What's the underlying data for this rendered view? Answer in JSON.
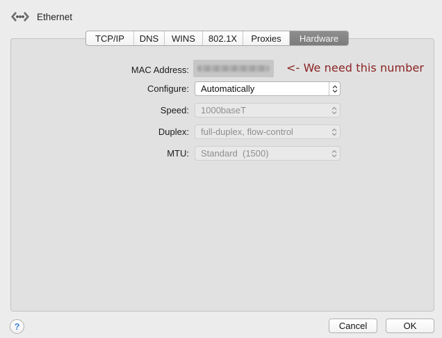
{
  "window": {
    "title": "Ethernet"
  },
  "tabs": [
    {
      "label": "TCP/IP"
    },
    {
      "label": "DNS"
    },
    {
      "label": "WINS"
    },
    {
      "label": "802.1X"
    },
    {
      "label": "Proxies"
    },
    {
      "label": "Hardware",
      "active": true
    }
  ],
  "form": {
    "mac_address": {
      "label": "MAC Address:"
    },
    "configure": {
      "label": "Configure:",
      "value": "Automatically"
    },
    "speed": {
      "label": "Speed:",
      "value": "1000baseT"
    },
    "duplex": {
      "label": "Duplex:",
      "value": "full-duplex, flow-control"
    },
    "mtu": {
      "label": "MTU:",
      "value": "Standard  (1500)"
    }
  },
  "annotation": {
    "text": "<- We need this number",
    "color": "#8b2323"
  },
  "footer": {
    "help_label": "?",
    "cancel_label": "Cancel",
    "ok_label": "OK"
  }
}
